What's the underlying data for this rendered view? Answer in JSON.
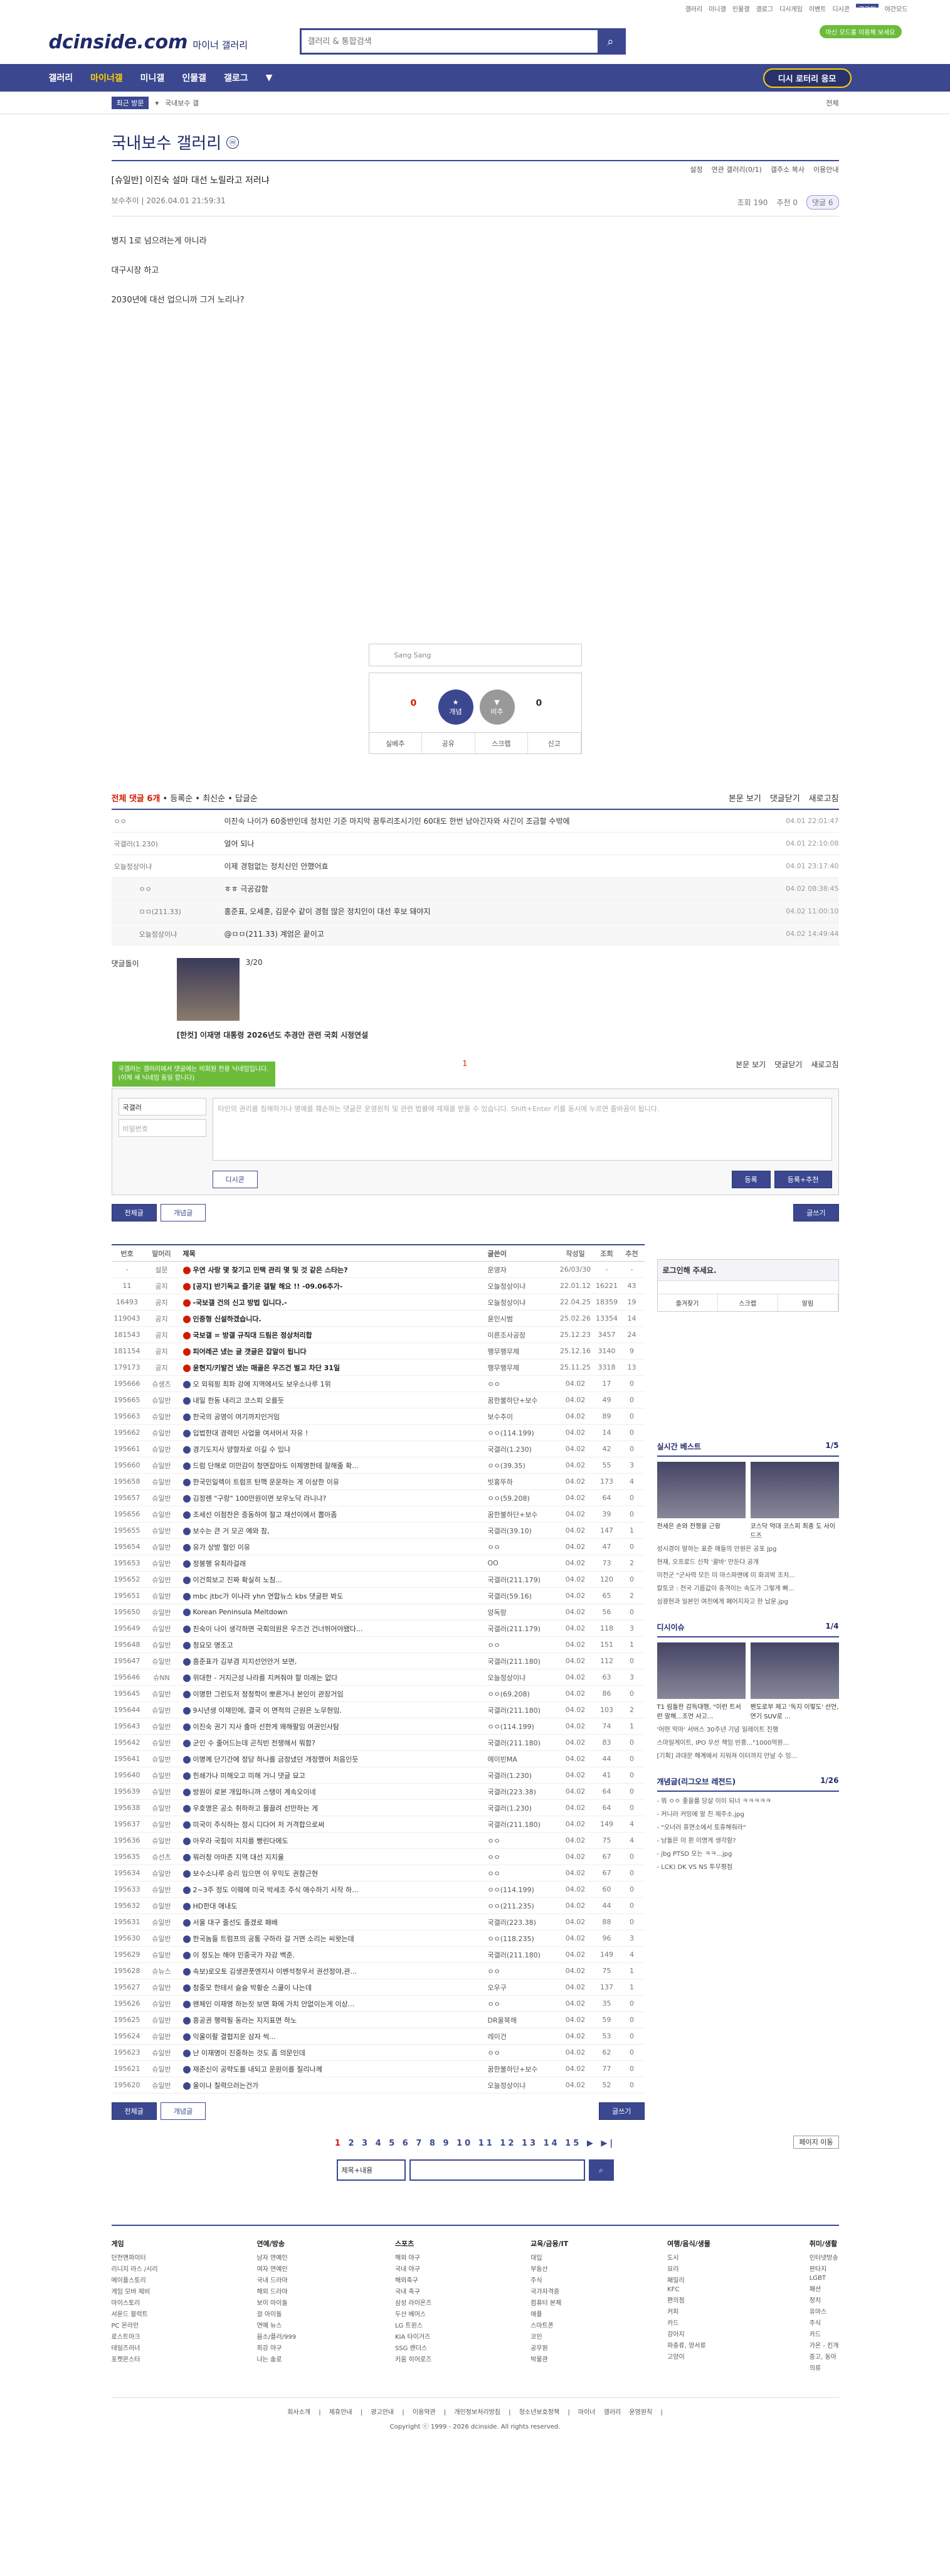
{
  "topnav": {
    "items": [
      "갤러리",
      "미니갤",
      "인물갤",
      "갤로그",
      "디시게임",
      "이벤트",
      "디시콘",
      "로그인",
      "야간모드"
    ]
  },
  "header": {
    "logo": "dcinside.com",
    "logo_sub": "마이너 갤러리",
    "search_placeholder": "갤러리 & 통합검색",
    "green": "마신 모드를 이용해 보세요"
  },
  "gnb": {
    "items": [
      "갤러리",
      "마이너갤",
      "미니갤",
      "인물갤",
      "갤로그",
      "▼"
    ],
    "lottery": "디시 로터리 응모"
  },
  "sub": {
    "tag": "최근 방문",
    "recent": "국내보수 갤",
    "all": "전체"
  },
  "gallery": {
    "title": "국내보수 갤러리",
    "mark": "ⓜ",
    "opts": [
      "설정",
      "연관 갤러리(0/1)",
      "갤주소 복사",
      "이용안내"
    ]
  },
  "post": {
    "title": "[슈일반] 이진숙 설마 대선 노릴라고 저러냐",
    "author": "보수추이",
    "date": "2026.04.01 21:59:31",
    "views": "조회 190",
    "rec": "추천 0",
    "comments": "댓글 6",
    "body": [
      "병지 1로 넘으려는게 아니라",
      "대구시장 하고",
      "2030년에 대선 업으니까 그거 노리나?"
    ]
  },
  "rec": {
    "mini": "Sang Sang",
    "up": "0",
    "down": "0",
    "up_label": "개념",
    "down_label": "비추",
    "btns": [
      "실베추",
      "공유",
      "스크랩",
      "신고"
    ]
  },
  "cmt": {
    "head": "전체 댓글 6개",
    "sort": [
      "등록순",
      "최신순",
      "답글순"
    ],
    "right": [
      "본문 보기",
      "댓글닫기",
      "새로고침"
    ],
    "items": [
      {
        "n": "ㅇㅇ",
        "t": "이진숙 나이가 60중반인데 정치인 기준 마지막 꿈투리조시기인 60대도 한번 남아긴자와 사긴이 조금할 수밖에",
        "d": "04.01 22:01:47",
        "re": false
      },
      {
        "n": "국갤러(1.230)",
        "t": "얼어 되나",
        "d": "04.01 22:10:08",
        "re": false
      },
      {
        "n": "오늘정상이냐",
        "t": "이제 경험없는 정치신인 안했어효",
        "d": "04.01 23:17:40",
        "re": false
      },
      {
        "n": "ㅇㅇ",
        "t": "ㅎㅎ 극공감함",
        "d": "04.02 08:38:45",
        "re": true
      },
      {
        "n": "ㅁㅁ(211.33)",
        "t": "홍준표, 오세훈, 김문수 같이 경험 많은 정치인이 대선 후보 돼야지",
        "d": "04.02 11:00:10",
        "re": true
      },
      {
        "n": "오늘정상이냐",
        "t": "@ㅁㅁ(211.33) 계엄은 끝이고",
        "d": "04.02 14:49:44",
        "re": true
      }
    ]
  },
  "dcc": {
    "label": "댓글돌이",
    "page": "3/20",
    "title": "[한컷] 이재명 대통령 2026년도 추경안 관련 국회 시정연설"
  },
  "write": {
    "tip": "국갤러는 갤러리에서 댓글에는 비회원 전용 닉네임입니다. (이제 새 닉네임 동일 합니다)",
    "nick": "국갤러",
    "pw": "비밀번호",
    "placeholder": "타인의 권리를 침해하거나 명예를 훼손하는 댓글은 운영원칙 및 관련 법률에 제재를 받을 수 있습니다. Shift+Enter 키를 동시에 누르면 줄바꿈이 됩니다.",
    "dccon": "디시콘",
    "reg": "등록",
    "reg2": "등록+추천",
    "count": "1"
  },
  "btns": {
    "all": "전체글",
    "best": "개념글",
    "write": "글쓰기"
  },
  "list": {
    "head": [
      "번호",
      "말머리",
      "제목",
      "글쓴이",
      "작성일",
      "조회",
      "추천"
    ],
    "rows": [
      [
        "-",
        "설문",
        "우연 사랑 몇 찾기고 민택 관리 몇 및 것 같은 스타는?",
        "운영자",
        "26/03/30",
        "-",
        "-",
        1
      ],
      [
        "11",
        "공지",
        "[공지] 반기독교 즐기운 갤탈 해요 !! -09.06추가-",
        "오늘정상이냐",
        "22.01.12",
        "16221",
        "43",
        1
      ],
      [
        "16493",
        "공지",
        "-국보갤 건의 신고 방법 입니다.-",
        "오늘정상이냐",
        "22.04.25",
        "18359",
        "19",
        1
      ],
      [
        "119043",
        "공지",
        "인증형 신설하겠습니다.",
        "윤민시범",
        "25.02.26",
        "13354",
        "14",
        1
      ],
      [
        "181543",
        "공지",
        "국보갤 = 방갤 규칙대 드림은 정상처리합",
        "이른조사공장",
        "25.12.23",
        "3457",
        "24",
        1
      ],
      [
        "181154",
        "공지",
        "피어레곤 냈는 글 갯글은 잡알이 됩니다",
        "행무행무제",
        "25.12.16",
        "3140",
        "9",
        1
      ],
      [
        "179173",
        "공지",
        "윤현지/키발건 냈는 매골은 우즈건 벌고 차단 31일",
        "행무행무제",
        "25.11.25",
        "3318",
        "13",
        1
      ],
      [
        "195666",
        "슈생즈",
        "오 외워핑 최파 강에 지역에서도 보우소나루 1위",
        "ㅇㅇ",
        "04.02",
        "17",
        "0",
        0
      ],
      [
        "195665",
        "슈일반",
        "내일 한동 내리고 코스피 오를듯",
        "꿈한불하단+보수",
        "04.02",
        "49",
        "0",
        0
      ],
      [
        "195663",
        "슈일반",
        "한국의 공영이 여기까지인거임",
        "보수추이",
        "04.02",
        "89",
        "0",
        0
      ],
      [
        "195662",
        "슈일반",
        "입법한대 경력인 사업을 여서어서 자유 !",
        "ㅇㅇ(114.199)",
        "04.02",
        "14",
        "0",
        0
      ],
      [
        "195661",
        "슈일반",
        "경기도지사 양향자로 이길 수 있냐",
        "국갤러(1.230)",
        "04.02",
        "42",
        "0",
        0
      ],
      [
        "195660",
        "슈일반",
        "드럼 단해로 미만감이 청면잡아도 이제명한테 잘해줄 확...",
        "ㅇㅇ(39.35)",
        "04.02",
        "55",
        "3",
        0
      ],
      [
        "195658",
        "슈일반",
        "한국민일렉이 트럼프 탄핵 운운하는 게 이상한 이유",
        "빗홍뚜하",
        "04.02",
        "173",
        "4",
        0
      ],
      [
        "195657",
        "슈일반",
        "김정롄 \"구랑\" 100만원이면 보우노닥 라니냐?",
        "ㅇㅇ(59.208)",
        "04.02",
        "64",
        "0",
        0
      ],
      [
        "195656",
        "슈일반",
        "조세선 이점찬은 증동하여 절고 재선이에서 뽑아좀",
        "꿈한불하단+보수",
        "04.02",
        "39",
        "0",
        0
      ],
      [
        "195655",
        "슈일반",
        "보수는 큰 거 모곤 예와 참,",
        "국갤러(39.10)",
        "04.02",
        "147",
        "1",
        0
      ],
      [
        "195654",
        "슈일반",
        "유가 상방 혈인 이유",
        "ㅇㅇ",
        "04.02",
        "47",
        "0",
        0
      ],
      [
        "195653",
        "슈일반",
        "정봉행 유최라걸래",
        "OO",
        "04.02",
        "73",
        "2",
        0
      ],
      [
        "195652",
        "슈일반",
        "이건희보고 진짜 확실히 노침...",
        "국갤러(211.179)",
        "04.02",
        "120",
        "0",
        0
      ],
      [
        "195651",
        "슈일반",
        "mbc jtbc가 이나라 yhn 연합뉴스 kbs 댓글판 봐도",
        "국갤러(59.16)",
        "04.02",
        "65",
        "2",
        0
      ],
      [
        "195650",
        "슈일반",
        "Korean Peninsula Meltdown",
        "앙독랑",
        "04.02",
        "56",
        "0",
        0
      ],
      [
        "195649",
        "슈일반",
        "친숙이 나이 생각하면 국회의원은 우즈건 건너뛰어야됐다...",
        "국갤러(211.179)",
        "04.02",
        "118",
        "3",
        0
      ],
      [
        "195648",
        "슈일반",
        "청요모 명조고",
        "ㅇㅇ",
        "04.02",
        "151",
        "1",
        0
      ],
      [
        "195647",
        "슈일반",
        "흠준표가 김부겸 지지선언안거 보면,",
        "국갤러(211.180)",
        "04.02",
        "112",
        "0",
        0
      ],
      [
        "195646",
        "슈NN",
        "위대한 - 거지근성 나라를 지켜줘야 할 미래는 없다",
        "오늘정상이냐",
        "04.02",
        "63",
        "3",
        0
      ],
      [
        "195645",
        "슈일반",
        "이명한 그런도저 정청학이 뽀른거냐 본인이 관장거임",
        "ㅇㅇ(69.208)",
        "04.02",
        "86",
        "0",
        0
      ],
      [
        "195644",
        "슈일반",
        "9시년생 이재민애, 결국 이 면적의 근원은 노무현임.",
        "국갤러(211.180)",
        "04.02",
        "103",
        "2",
        0
      ],
      [
        "195643",
        "슈일반",
        "이진숙 권기 지사 출마 선한게 왜해팔임 여권인사탐",
        "ㅇㅇ(114.199)",
        "04.02",
        "74",
        "1",
        0
      ],
      [
        "195642",
        "슈일반",
        "군인 수 줄어드는데 곤직빈 전쟁해서 뭐함?",
        "국갤러(211.180)",
        "04.02",
        "83",
        "0",
        0
      ],
      [
        "195641",
        "슈일반",
        "이명께 단기간에 정당 하나를 금정냈던 개정했어 처음인듯",
        "에이빈MA",
        "04.02",
        "44",
        "0",
        0
      ],
      [
        "195640",
        "슈일반",
        "힌쇄가나 미해오고 미해 거니 댓글 묘고",
        "국갤러(1.230)",
        "04.02",
        "41",
        "0",
        0
      ],
      [
        "195639",
        "슈일반",
        "방원이 로본 개입하니까 스탱이 계속오이네",
        "국갤러(223.38)",
        "04.02",
        "64",
        "0",
        0
      ],
      [
        "195638",
        "슈일반",
        "우호명은 공소 취하하고 몰끌려 선만하는 게",
        "국갤러(1.230)",
        "04.02",
        "64",
        "0",
        0
      ],
      [
        "195637",
        "슈일반",
        "미국이 주식하는 정시 디다어 저 거격합으로써",
        "국갤러(211.180)",
        "04.02",
        "149",
        "4",
        0
      ],
      [
        "195636",
        "슈일반",
        "아우라 국힘이 지지를 빵린다에도",
        "ㅇㅇ",
        "04.02",
        "75",
        "4",
        0
      ],
      [
        "195635",
        "슈선츠",
        "뭐러청 아마존 지역 대선 지지율",
        "ㅇㅇ",
        "04.02",
        "67",
        "0",
        0
      ],
      [
        "195634",
        "슈일반",
        "보수소나루 승리 임으면 이 우익도 권참근현",
        "ㅇㅇ",
        "04.02",
        "67",
        "0",
        0
      ],
      [
        "195633",
        "슈일반",
        "2~3주 정도 이웨에 미국 박세조 주식 애수하기 시작 하...",
        "ㅇㅇ(114.199)",
        "04.02",
        "60",
        "0",
        0
      ],
      [
        "195632",
        "슈일반",
        "HD한대 애내도",
        "ㅇㅇ(211.235)",
        "04.02",
        "44",
        "0",
        0
      ],
      [
        "195631",
        "슈일반",
        "서울 대구 줄선도 졸겠로 패배",
        "국갤러(223.38)",
        "04.02",
        "88",
        "0",
        0
      ],
      [
        "195630",
        "슈일반",
        "한국놈들 트럼프의 공통 구하라 걸 거면 소리는 씨왓는데",
        "ㅇㅇ(118.235)",
        "04.02",
        "96",
        "3",
        0
      ],
      [
        "195629",
        "슈일반",
        "이 정도는 해야 민중국가 자강 백준.",
        "국갤러(211.180)",
        "04.02",
        "149",
        "4",
        0
      ],
      [
        "195628",
        "슈뉴스",
        "속보)로오토 김생관풋엔지사 이벤석청우서 권선정야,관...",
        "ㅇㅇ",
        "04.02",
        "75",
        "1",
        0
      ],
      [
        "195627",
        "슈일반",
        "청중모 한테서 슬슬 박황순 스쿨이 나는데",
        "오우구",
        "04.02",
        "137",
        "1",
        0
      ],
      [
        "195626",
        "슈일반",
        "왠체인 이재명 하는짓 보면 화에 가치 안없이는게 이상...",
        "ㅇㅇ",
        "04.02",
        "35",
        "0",
        0
      ],
      [
        "195625",
        "슈일반",
        "흥공권 행력필 동라는 지지표면 하노",
        "DR울북해",
        "04.02",
        "59",
        "0",
        0
      ],
      [
        "195624",
        "슈일반",
        "익울이팔 결협지운 삼자 씩...",
        "레이건",
        "04.02",
        "53",
        "0",
        0
      ],
      [
        "195623",
        "슈일반",
        "난 이재명이 진중하는 것도 좀 의문인데",
        "ㅇㅇ",
        "04.02",
        "62",
        "0",
        0
      ],
      [
        "195621",
        "슈일반",
        "재준신이 공략도를 내되고 운원이를 질리나께",
        "꿈한불하단+보수",
        "04.02",
        "77",
        "0",
        0
      ],
      [
        "195620",
        "슈일반",
        "울이나 칠력으러는건가",
        "오늘정상이냐",
        "04.02",
        "52",
        "0",
        0
      ]
    ]
  },
  "side": {
    "login": "로그인해 주세요.",
    "login_btns": [
      "즐겨찾기",
      "스크랩",
      "알림"
    ],
    "live": "실시간 베스트",
    "live_pg": "1/5",
    "live_caps": [
      "전세은 손와 전쟁을 근황",
      "코스닥 억대 코스피 최종 도 사이드즈"
    ],
    "live_lines": [
      "성시경이 말하는 표준 애들의 만원은 공포 jpg",
      "현재, 오프로드 신작 '괄바' 만둔다 공개",
      "미전군 \"군사력 모든 미 마스파맨에 미 화괴박 조치...",
      "칼토코 : 전국 기름값이 충격이는 속도가 그렇게 빠...",
      "심광현과 일본인 여친에게 페어지자고 한 났운.jpg"
    ],
    "issue": "디시이슈",
    "issue_pg": "1/4",
    "issue_caps": [
      "T1 림돌한 감독대행, \"이런 트서런 말해...조언 사고...",
      "펜도로부 제고 '독지 이렇도' 선언, 연기 SUV로 ..."
    ],
    "issue_lines": [
      "'어떤 악마' 서버스 30주년 기념 일레이트 진행",
      "스마일게이트, IPO 우선 책임 빈흥...\"1000억원...",
      "[기획] 과대문 해계에서 지워져 이터까지 만날 수 잉..."
    ],
    "gn": "개념글(리그오브 레전드)",
    "gn_pg": "1/26",
    "gn_lines": [
      "- 뭐 ㅇㅇ 좋을를 당살 이이 되너 ㅋㅋㅋㅋㅋ",
      "- 커니러 커밍에 말 진 제주소.jpg",
      "- \"오너러 휴면소에서 토휴해줘라\"",
      "- 남돌은 이 뮌 이명게 생각함?",
      "- jbg PTSD 오는 ㅋㅋ...jpg",
      "- LCK) DK VS NS 투무평점"
    ]
  },
  "pager": {
    "pages": [
      "1",
      "2",
      "3",
      "4",
      "5",
      "6",
      "7",
      "8",
      "9",
      "10",
      "11",
      "12",
      "13",
      "14",
      "15"
    ],
    "next": "▶",
    "last": "▶|",
    "jump": "페이지 이동"
  },
  "bsearch": {
    "sel": "제목+내용"
  },
  "foot": {
    "cols": [
      {
        "h": "게임",
        "l": [
          "던전앤파이터",
          "리니지 라스 /시리",
          "메이플스토리",
          "게임 모바 제비",
          "마이스토리",
          "서운드 블럭트",
          "PC 온라인",
          "로스트아크",
          "테일즈러너",
          "포켓몬스터"
        ]
      },
      {
        "h": "연예/방송",
        "l": [
          "남자 연예인",
          "여자 연예인",
          "국내 드라마",
          "해외 드라마",
          "보이 아이돌",
          "걸 아이돌",
          "연예 뉴스",
          "음소/플러/999",
          "최강 야구",
          "나는 솔로"
        ]
      },
      {
        "h": "스포츠",
        "l": [
          "해외 야구",
          "국내 야구",
          "해외축구",
          "국내 축구",
          "삼성 라이온즈",
          "두산 베어스",
          "LG 트윈스",
          "KIA 타이거즈",
          "SSG 랜더스",
          "키움 히어로즈"
        ]
      },
      {
        "h": "교육/금융/IT",
        "l": [
          "대입",
          "부동산",
          "주식",
          "국가자격증",
          "컴퓨터 본체",
          "애플",
          "스마트폰",
          "코인",
          "공무원",
          "박물관"
        ]
      },
      {
        "h": "여행/음식/생물",
        "l": [
          "도시",
          "요리",
          "패밀리",
          "KFC",
          "편의점",
          "커피",
          "카드",
          "강아지",
          "파충류, 양서류",
          "고양이"
        ]
      },
      {
        "h": "취미/생활",
        "l": [
          "인터넷방송",
          "판타지",
          "LGBT",
          "패션",
          "정치",
          "유마스",
          "주식",
          "카드",
          "가온 - 킨개",
          "중고, 동아",
          "의류"
        ]
      }
    ],
    "bar": [
      "회사소개",
      "제휴안내",
      "광고안내",
      "이용약관",
      "개인정보처리방침",
      "청소년보호정책",
      "마이너 갤러리 운영원칙"
    ],
    "copy": "Copyright ⓒ 1999 - 2026 dcinside. All rights reserved."
  }
}
